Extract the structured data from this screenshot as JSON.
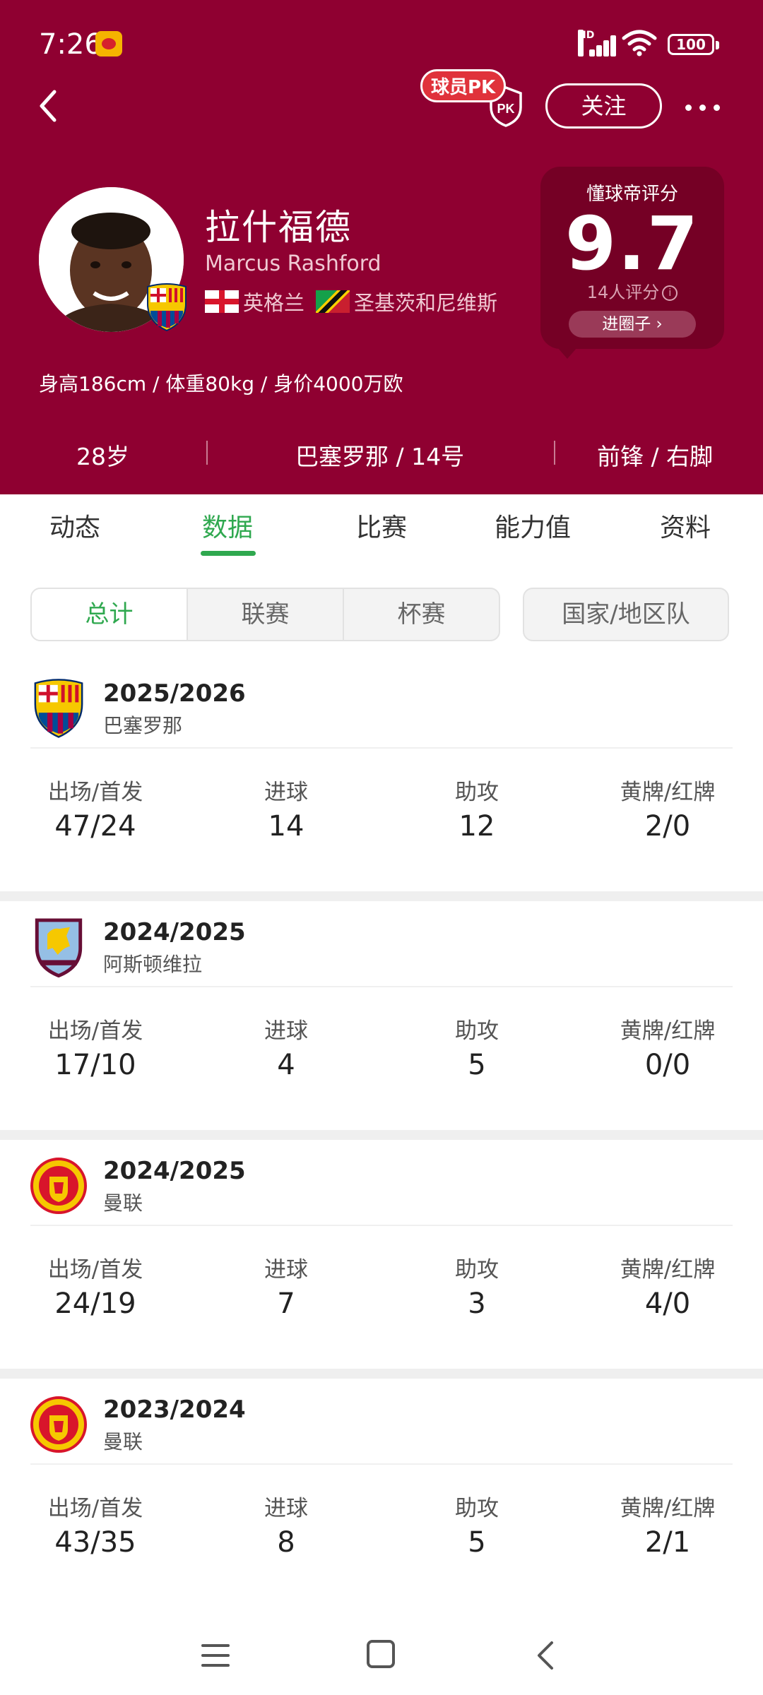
{
  "status_bar": {
    "time": "7:26",
    "hd": "HD",
    "battery": "100"
  },
  "header": {
    "pk_label": "球员PK",
    "pk_icon": "PK",
    "follow_label": "关注",
    "player": {
      "name_cn": "拉什福德",
      "name_en": "Marcus Rashford",
      "nationality_1": "英格兰",
      "nationality_2": "圣基茨和尼维斯",
      "physical": "身高186cm / 体重80kg / 身价4000万欧"
    },
    "rating": {
      "title": "懂球帝评分",
      "score": "9.7",
      "count": "14人评分",
      "button": "进圈子"
    },
    "meta": {
      "age": "28岁",
      "club_number": "巴塞罗那 / 14号",
      "position_foot": "前锋 / 右脚"
    }
  },
  "tabs": [
    "动态",
    "数据",
    "比赛",
    "能力值",
    "资料"
  ],
  "active_tab": "数据",
  "filters": {
    "segments": [
      "总计",
      "联赛",
      "杯赛"
    ],
    "national": "国家/地区队"
  },
  "stat_labels": {
    "apps": "出场/首发",
    "goals": "进球",
    "assists": "助攻",
    "cards": "黄牌/红牌"
  },
  "seasons": [
    {
      "year": "2025/2026",
      "club": "巴塞罗那",
      "logo": "barcelona-crest",
      "apps": "47/24",
      "goals": "14",
      "assists": "12",
      "cards": "2/0"
    },
    {
      "year": "2024/2025",
      "club": "阿斯顿维拉",
      "logo": "aston-villa-crest",
      "apps": "17/10",
      "goals": "4",
      "assists": "5",
      "cards": "0/0"
    },
    {
      "year": "2024/2025",
      "club": "曼联",
      "logo": "man-united-crest",
      "apps": "24/19",
      "goals": "7",
      "assists": "3",
      "cards": "4/0"
    },
    {
      "year": "2023/2024",
      "club": "曼联",
      "logo": "man-united-crest",
      "apps": "43/35",
      "goals": "8",
      "assists": "5",
      "cards": "2/1"
    }
  ],
  "colors": {
    "header_bg": "#8f0031",
    "accent_green": "#2fa84f",
    "rating_bg": "#750025"
  }
}
